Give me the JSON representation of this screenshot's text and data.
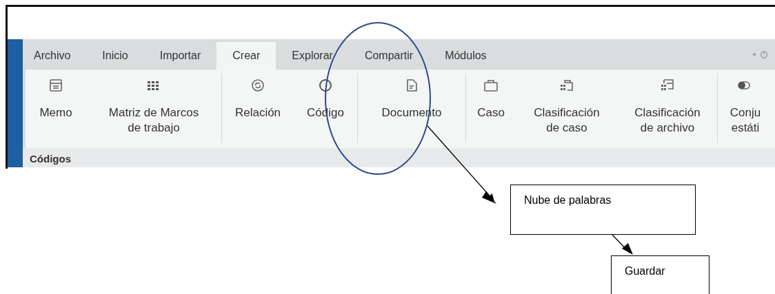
{
  "tabs": [
    {
      "label": "Archivo",
      "selected": false
    },
    {
      "label": "Inicio",
      "selected": false
    },
    {
      "label": "Importar",
      "selected": false
    },
    {
      "label": "Crear",
      "selected": true
    },
    {
      "label": "Explorar",
      "selected": false
    },
    {
      "label": "Compartir",
      "selected": false
    },
    {
      "label": "Módulos",
      "selected": false
    }
  ],
  "ribbon_groups": [
    [
      {
        "label": "Memo",
        "kind": "memo"
      },
      {
        "label": "Matriz de Marcos\nde trabajo",
        "kind": "matrix"
      }
    ],
    [
      {
        "label": "Relación",
        "kind": "relation"
      },
      {
        "label": "Código",
        "kind": "code"
      }
    ],
    [
      {
        "label": "Documento",
        "kind": "document"
      }
    ],
    [
      {
        "label": "Caso",
        "kind": "case"
      },
      {
        "label": "Clasificación\nde caso",
        "kind": "case-class"
      },
      {
        "label": "Clasificación\nde archivo",
        "kind": "file-class"
      }
    ],
    [
      {
        "label": "Conju\nestáti",
        "kind": "toggle"
      }
    ]
  ],
  "panel": {
    "title": "Códigos"
  },
  "callouts": [
    {
      "text": "Nube de palabras"
    },
    {
      "text": "Guardar"
    }
  ]
}
